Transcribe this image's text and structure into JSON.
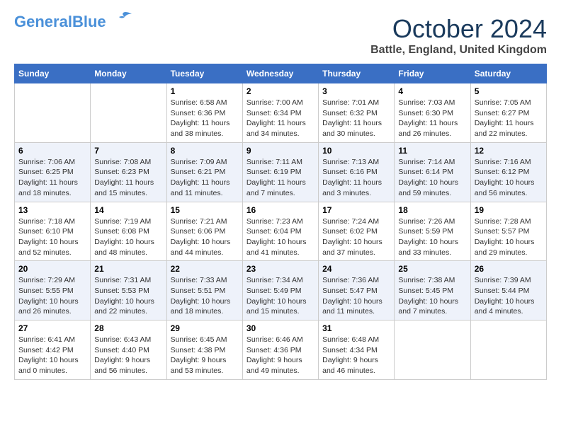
{
  "logo": {
    "general": "General",
    "blue": "Blue"
  },
  "title": "October 2024",
  "location": "Battle, England, United Kingdom",
  "weekdays": [
    "Sunday",
    "Monday",
    "Tuesday",
    "Wednesday",
    "Thursday",
    "Friday",
    "Saturday"
  ],
  "weeks": [
    [
      {
        "day": "",
        "info": ""
      },
      {
        "day": "",
        "info": ""
      },
      {
        "day": "1",
        "info": "Sunrise: 6:58 AM\nSunset: 6:36 PM\nDaylight: 11 hours and 38 minutes."
      },
      {
        "day": "2",
        "info": "Sunrise: 7:00 AM\nSunset: 6:34 PM\nDaylight: 11 hours and 34 minutes."
      },
      {
        "day": "3",
        "info": "Sunrise: 7:01 AM\nSunset: 6:32 PM\nDaylight: 11 hours and 30 minutes."
      },
      {
        "day": "4",
        "info": "Sunrise: 7:03 AM\nSunset: 6:30 PM\nDaylight: 11 hours and 26 minutes."
      },
      {
        "day": "5",
        "info": "Sunrise: 7:05 AM\nSunset: 6:27 PM\nDaylight: 11 hours and 22 minutes."
      }
    ],
    [
      {
        "day": "6",
        "info": "Sunrise: 7:06 AM\nSunset: 6:25 PM\nDaylight: 11 hours and 18 minutes."
      },
      {
        "day": "7",
        "info": "Sunrise: 7:08 AM\nSunset: 6:23 PM\nDaylight: 11 hours and 15 minutes."
      },
      {
        "day": "8",
        "info": "Sunrise: 7:09 AM\nSunset: 6:21 PM\nDaylight: 11 hours and 11 minutes."
      },
      {
        "day": "9",
        "info": "Sunrise: 7:11 AM\nSunset: 6:19 PM\nDaylight: 11 hours and 7 minutes."
      },
      {
        "day": "10",
        "info": "Sunrise: 7:13 AM\nSunset: 6:16 PM\nDaylight: 11 hours and 3 minutes."
      },
      {
        "day": "11",
        "info": "Sunrise: 7:14 AM\nSunset: 6:14 PM\nDaylight: 10 hours and 59 minutes."
      },
      {
        "day": "12",
        "info": "Sunrise: 7:16 AM\nSunset: 6:12 PM\nDaylight: 10 hours and 56 minutes."
      }
    ],
    [
      {
        "day": "13",
        "info": "Sunrise: 7:18 AM\nSunset: 6:10 PM\nDaylight: 10 hours and 52 minutes."
      },
      {
        "day": "14",
        "info": "Sunrise: 7:19 AM\nSunset: 6:08 PM\nDaylight: 10 hours and 48 minutes."
      },
      {
        "day": "15",
        "info": "Sunrise: 7:21 AM\nSunset: 6:06 PM\nDaylight: 10 hours and 44 minutes."
      },
      {
        "day": "16",
        "info": "Sunrise: 7:23 AM\nSunset: 6:04 PM\nDaylight: 10 hours and 41 minutes."
      },
      {
        "day": "17",
        "info": "Sunrise: 7:24 AM\nSunset: 6:02 PM\nDaylight: 10 hours and 37 minutes."
      },
      {
        "day": "18",
        "info": "Sunrise: 7:26 AM\nSunset: 5:59 PM\nDaylight: 10 hours and 33 minutes."
      },
      {
        "day": "19",
        "info": "Sunrise: 7:28 AM\nSunset: 5:57 PM\nDaylight: 10 hours and 29 minutes."
      }
    ],
    [
      {
        "day": "20",
        "info": "Sunrise: 7:29 AM\nSunset: 5:55 PM\nDaylight: 10 hours and 26 minutes."
      },
      {
        "day": "21",
        "info": "Sunrise: 7:31 AM\nSunset: 5:53 PM\nDaylight: 10 hours and 22 minutes."
      },
      {
        "day": "22",
        "info": "Sunrise: 7:33 AM\nSunset: 5:51 PM\nDaylight: 10 hours and 18 minutes."
      },
      {
        "day": "23",
        "info": "Sunrise: 7:34 AM\nSunset: 5:49 PM\nDaylight: 10 hours and 15 minutes."
      },
      {
        "day": "24",
        "info": "Sunrise: 7:36 AM\nSunset: 5:47 PM\nDaylight: 10 hours and 11 minutes."
      },
      {
        "day": "25",
        "info": "Sunrise: 7:38 AM\nSunset: 5:45 PM\nDaylight: 10 hours and 7 minutes."
      },
      {
        "day": "26",
        "info": "Sunrise: 7:39 AM\nSunset: 5:44 PM\nDaylight: 10 hours and 4 minutes."
      }
    ],
    [
      {
        "day": "27",
        "info": "Sunrise: 6:41 AM\nSunset: 4:42 PM\nDaylight: 10 hours and 0 minutes."
      },
      {
        "day": "28",
        "info": "Sunrise: 6:43 AM\nSunset: 4:40 PM\nDaylight: 9 hours and 56 minutes."
      },
      {
        "day": "29",
        "info": "Sunrise: 6:45 AM\nSunset: 4:38 PM\nDaylight: 9 hours and 53 minutes."
      },
      {
        "day": "30",
        "info": "Sunrise: 6:46 AM\nSunset: 4:36 PM\nDaylight: 9 hours and 49 minutes."
      },
      {
        "day": "31",
        "info": "Sunrise: 6:48 AM\nSunset: 4:34 PM\nDaylight: 9 hours and 46 minutes."
      },
      {
        "day": "",
        "info": ""
      },
      {
        "day": "",
        "info": ""
      }
    ]
  ]
}
